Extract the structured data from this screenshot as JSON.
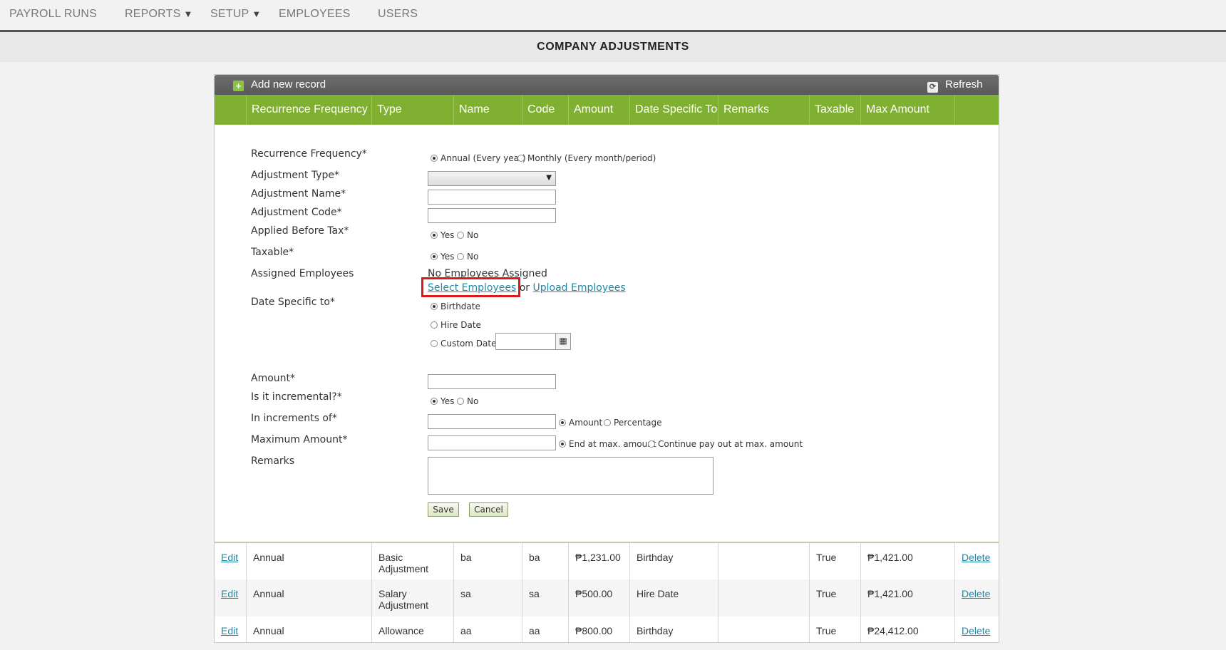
{
  "nav": {
    "items": [
      {
        "label": "PAYROLL RUNS",
        "caret": ""
      },
      {
        "label": "REPORTS",
        "caret": "▼"
      },
      {
        "label": "SETUP",
        "caret": "▼"
      },
      {
        "label": "EMPLOYEES",
        "caret": ""
      },
      {
        "label": "USERS",
        "caret": ""
      }
    ]
  },
  "page": {
    "title": "COMPANY ADJUSTMENTS"
  },
  "toolbar": {
    "add_label": "Add new record",
    "refresh_label": "Refresh"
  },
  "columns": [
    "Recurrence Frequency",
    "Type",
    "Name",
    "Code",
    "Amount",
    "Date Specific To",
    "Remarks",
    "Taxable",
    "Max Amount"
  ],
  "form": {
    "recurrence_label": "Recurrence Frequency*",
    "recurrence_options": [
      "Annual (Every year)",
      "Monthly (Every month/period)"
    ],
    "adjustment_type_label": "Adjustment Type*",
    "adjustment_type_value": "",
    "adjustment_name_label": "Adjustment Name*",
    "adjustment_code_label": "Adjustment Code*",
    "applied_before_tax_label": "Applied Before Tax*",
    "yes": "Yes",
    "no": "No",
    "taxable_label": "Taxable*",
    "assigned_employees_label": "Assigned Employees",
    "no_employees_text": "No Employees Assigned",
    "select_employees_link": "Select Employees",
    "or_text": "or",
    "upload_employees_link": "Upload Employees",
    "date_specific_label": "Date Specific to*",
    "date_options": [
      "Birthdate",
      "Hire Date",
      "Custom Date"
    ],
    "amount_label": "Amount*",
    "incremental_label": "Is it incremental?*",
    "increments_label": "In increments of*",
    "increment_types": [
      "Amount",
      "Percentage"
    ],
    "max_amount_label": "Maximum Amount*",
    "max_options": [
      "End at max. amount",
      "Continue pay out at max. amount"
    ],
    "remarks_label": "Remarks",
    "save_label": "Save",
    "cancel_label": "Cancel"
  },
  "rows": [
    {
      "edit": "Edit",
      "recurrence": "Annual",
      "type": "Basic Adjustment",
      "name": "ba",
      "code": "ba",
      "amount": "₱1,231.00",
      "date_specific": "Birthday",
      "remarks": "",
      "taxable": "True",
      "max_amount": "₱1,421.00",
      "delete": "Delete"
    },
    {
      "edit": "Edit",
      "recurrence": "Annual",
      "type": "Salary Adjustment",
      "name": "sa",
      "code": "sa",
      "amount": "₱500.00",
      "date_specific": "Hire Date",
      "remarks": "",
      "taxable": "True",
      "max_amount": "₱1,421.00",
      "delete": "Delete"
    },
    {
      "edit": "Edit",
      "recurrence": "Annual",
      "type": "Allowance",
      "name": "aa",
      "code": "aa",
      "amount": "₱800.00",
      "date_specific": "Birthday",
      "remarks": "",
      "taxable": "True",
      "max_amount": "₱24,412.00",
      "delete": "Delete"
    }
  ]
}
